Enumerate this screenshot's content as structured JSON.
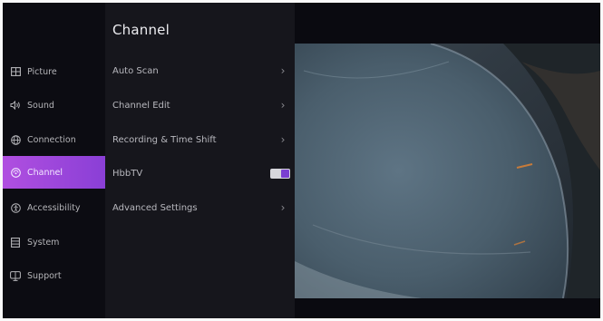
{
  "sidebar": {
    "items": [
      {
        "label": "Picture",
        "icon": "picture-icon",
        "active": false
      },
      {
        "label": "Sound",
        "icon": "sound-icon",
        "active": false
      },
      {
        "label": "Connection",
        "icon": "globe-icon",
        "active": false
      },
      {
        "label": "Channel",
        "icon": "channel-icon",
        "active": true
      },
      {
        "label": "Accessibility",
        "icon": "accessibility-icon",
        "active": false
      },
      {
        "label": "System",
        "icon": "system-icon",
        "active": false
      },
      {
        "label": "Support",
        "icon": "support-icon",
        "active": false
      }
    ]
  },
  "panel": {
    "title": "Channel",
    "items": [
      {
        "label": "Auto Scan",
        "control": "chevron-right-icon"
      },
      {
        "label": "Channel Edit",
        "control": "chevron-right-icon"
      },
      {
        "label": "Recording & Time Shift",
        "control": "chevron-right-icon"
      },
      {
        "label": "HbbTV",
        "control": "toggle",
        "toggle_on": true
      },
      {
        "label": "Advanced Settings",
        "control": "chevron-right-icon"
      }
    ]
  },
  "colors": {
    "accent": "#9b45dc",
    "toggle_knob": "#7a3fd0",
    "background": "#0a0a10",
    "panel": "#16161c"
  }
}
